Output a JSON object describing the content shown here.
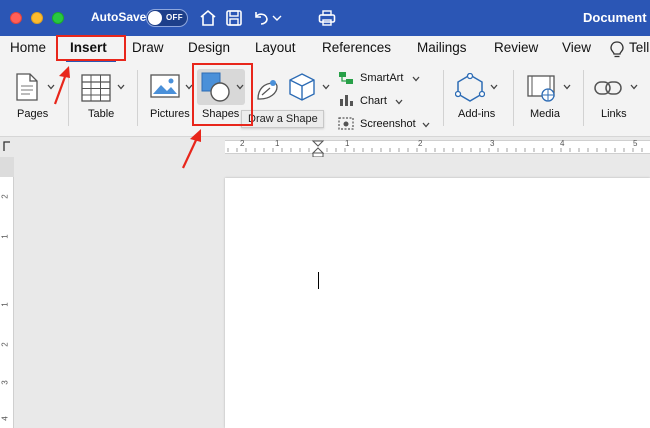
{
  "titlebar": {
    "autosave_label": "AutoSave",
    "autosave_state": "OFF",
    "document_title": "Document",
    "icons": [
      "home-icon",
      "save-icon",
      "undo-icon",
      "dropdown-chevron-icon",
      "print-icon"
    ]
  },
  "tabs": [
    {
      "label": "Home"
    },
    {
      "label": "Insert"
    },
    {
      "label": "Draw"
    },
    {
      "label": "Design"
    },
    {
      "label": "Layout"
    },
    {
      "label": "References"
    },
    {
      "label": "Mailings"
    },
    {
      "label": "Review"
    },
    {
      "label": "View"
    }
  ],
  "tell_me_label": "Tell",
  "ribbon": {
    "pages": "Pages",
    "table": "Table",
    "pictures": "Pictures",
    "shapes": "Shapes",
    "smartart": "SmartArt",
    "chart": "Chart",
    "screenshot": "Screenshot",
    "addins": "Add-ins",
    "media": "Media",
    "links": "Links"
  },
  "tooltip": "Draw a Shape",
  "ruler": {
    "top_numbers": [
      "2",
      "1",
      "1",
      "2",
      "3",
      "4",
      "5"
    ],
    "left_numbers": [
      "2",
      "1",
      "1",
      "2",
      "3",
      "4"
    ]
  },
  "colors": {
    "title_bar": "#2b56b5",
    "annotation_red": "#e8261b",
    "ribbon_bg": "#f3f3f3"
  }
}
